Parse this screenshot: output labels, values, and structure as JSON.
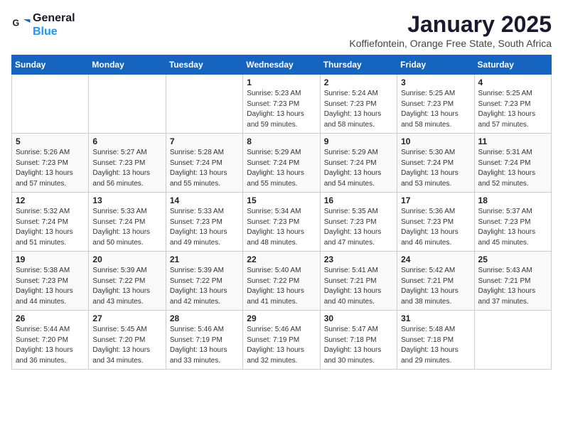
{
  "logo": {
    "line1": "General",
    "line2": "Blue"
  },
  "title": "January 2025",
  "location": "Koffiefontein, Orange Free State, South Africa",
  "weekdays": [
    "Sunday",
    "Monday",
    "Tuesday",
    "Wednesday",
    "Thursday",
    "Friday",
    "Saturday"
  ],
  "weeks": [
    [
      {
        "day": "",
        "info": ""
      },
      {
        "day": "",
        "info": ""
      },
      {
        "day": "",
        "info": ""
      },
      {
        "day": "1",
        "info": "Sunrise: 5:23 AM\nSunset: 7:23 PM\nDaylight: 13 hours\nand 59 minutes."
      },
      {
        "day": "2",
        "info": "Sunrise: 5:24 AM\nSunset: 7:23 PM\nDaylight: 13 hours\nand 58 minutes."
      },
      {
        "day": "3",
        "info": "Sunrise: 5:25 AM\nSunset: 7:23 PM\nDaylight: 13 hours\nand 58 minutes."
      },
      {
        "day": "4",
        "info": "Sunrise: 5:25 AM\nSunset: 7:23 PM\nDaylight: 13 hours\nand 57 minutes."
      }
    ],
    [
      {
        "day": "5",
        "info": "Sunrise: 5:26 AM\nSunset: 7:23 PM\nDaylight: 13 hours\nand 57 minutes."
      },
      {
        "day": "6",
        "info": "Sunrise: 5:27 AM\nSunset: 7:23 PM\nDaylight: 13 hours\nand 56 minutes."
      },
      {
        "day": "7",
        "info": "Sunrise: 5:28 AM\nSunset: 7:24 PM\nDaylight: 13 hours\nand 55 minutes."
      },
      {
        "day": "8",
        "info": "Sunrise: 5:29 AM\nSunset: 7:24 PM\nDaylight: 13 hours\nand 55 minutes."
      },
      {
        "day": "9",
        "info": "Sunrise: 5:29 AM\nSunset: 7:24 PM\nDaylight: 13 hours\nand 54 minutes."
      },
      {
        "day": "10",
        "info": "Sunrise: 5:30 AM\nSunset: 7:24 PM\nDaylight: 13 hours\nand 53 minutes."
      },
      {
        "day": "11",
        "info": "Sunrise: 5:31 AM\nSunset: 7:24 PM\nDaylight: 13 hours\nand 52 minutes."
      }
    ],
    [
      {
        "day": "12",
        "info": "Sunrise: 5:32 AM\nSunset: 7:24 PM\nDaylight: 13 hours\nand 51 minutes."
      },
      {
        "day": "13",
        "info": "Sunrise: 5:33 AM\nSunset: 7:24 PM\nDaylight: 13 hours\nand 50 minutes."
      },
      {
        "day": "14",
        "info": "Sunrise: 5:33 AM\nSunset: 7:23 PM\nDaylight: 13 hours\nand 49 minutes."
      },
      {
        "day": "15",
        "info": "Sunrise: 5:34 AM\nSunset: 7:23 PM\nDaylight: 13 hours\nand 48 minutes."
      },
      {
        "day": "16",
        "info": "Sunrise: 5:35 AM\nSunset: 7:23 PM\nDaylight: 13 hours\nand 47 minutes."
      },
      {
        "day": "17",
        "info": "Sunrise: 5:36 AM\nSunset: 7:23 PM\nDaylight: 13 hours\nand 46 minutes."
      },
      {
        "day": "18",
        "info": "Sunrise: 5:37 AM\nSunset: 7:23 PM\nDaylight: 13 hours\nand 45 minutes."
      }
    ],
    [
      {
        "day": "19",
        "info": "Sunrise: 5:38 AM\nSunset: 7:23 PM\nDaylight: 13 hours\nand 44 minutes."
      },
      {
        "day": "20",
        "info": "Sunrise: 5:39 AM\nSunset: 7:22 PM\nDaylight: 13 hours\nand 43 minutes."
      },
      {
        "day": "21",
        "info": "Sunrise: 5:39 AM\nSunset: 7:22 PM\nDaylight: 13 hours\nand 42 minutes."
      },
      {
        "day": "22",
        "info": "Sunrise: 5:40 AM\nSunset: 7:22 PM\nDaylight: 13 hours\nand 41 minutes."
      },
      {
        "day": "23",
        "info": "Sunrise: 5:41 AM\nSunset: 7:21 PM\nDaylight: 13 hours\nand 40 minutes."
      },
      {
        "day": "24",
        "info": "Sunrise: 5:42 AM\nSunset: 7:21 PM\nDaylight: 13 hours\nand 38 minutes."
      },
      {
        "day": "25",
        "info": "Sunrise: 5:43 AM\nSunset: 7:21 PM\nDaylight: 13 hours\nand 37 minutes."
      }
    ],
    [
      {
        "day": "26",
        "info": "Sunrise: 5:44 AM\nSunset: 7:20 PM\nDaylight: 13 hours\nand 36 minutes."
      },
      {
        "day": "27",
        "info": "Sunrise: 5:45 AM\nSunset: 7:20 PM\nDaylight: 13 hours\nand 34 minutes."
      },
      {
        "day": "28",
        "info": "Sunrise: 5:46 AM\nSunset: 7:19 PM\nDaylight: 13 hours\nand 33 minutes."
      },
      {
        "day": "29",
        "info": "Sunrise: 5:46 AM\nSunset: 7:19 PM\nDaylight: 13 hours\nand 32 minutes."
      },
      {
        "day": "30",
        "info": "Sunrise: 5:47 AM\nSunset: 7:18 PM\nDaylight: 13 hours\nand 30 minutes."
      },
      {
        "day": "31",
        "info": "Sunrise: 5:48 AM\nSunset: 7:18 PM\nDaylight: 13 hours\nand 29 minutes."
      },
      {
        "day": "",
        "info": ""
      }
    ]
  ]
}
